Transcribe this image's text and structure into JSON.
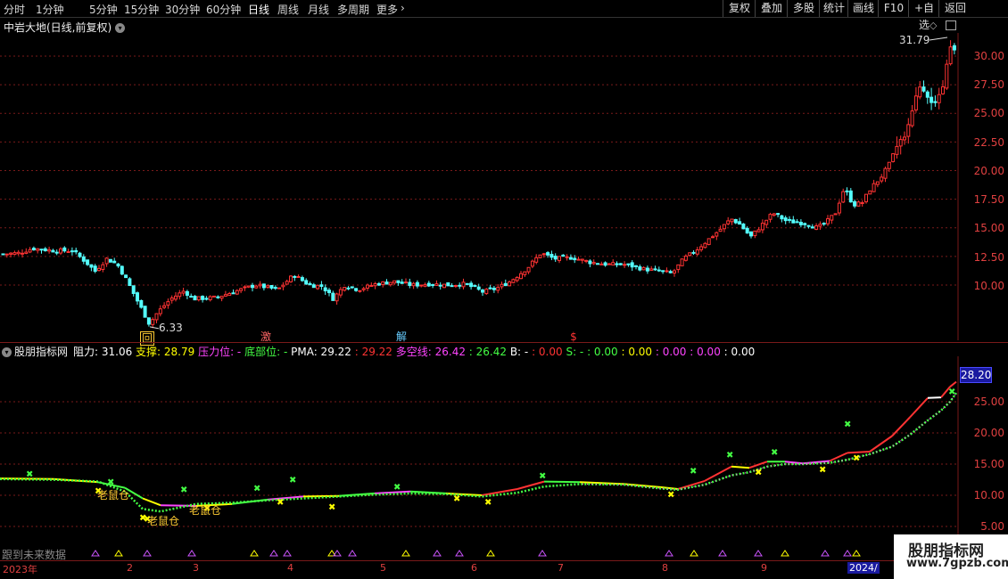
{
  "toolbar": {
    "periods": [
      "分时",
      "1分钟",
      "5分钟",
      "15分钟",
      "30分钟",
      "60分钟",
      "日线",
      "周线",
      "月线",
      "多周期",
      "更多"
    ],
    "active": "日线",
    "more_arrow": "›",
    "right_buttons": [
      "复权",
      "叠加",
      "多股",
      "统计",
      "画线",
      "F10",
      "+自选",
      "返回"
    ]
  },
  "chart_title": "中岩大地(日线,前复权)",
  "main": {
    "high_label": "31.79",
    "low_label": "6.33",
    "y_ticks": [
      "30.00",
      "27.50",
      "25.00",
      "22.50",
      "20.00",
      "17.50",
      "15.00",
      "12.50",
      "10.00"
    ],
    "signals": [
      {
        "text": "回",
        "color": "#ffcc33"
      },
      {
        "text": "激",
        "color": "#ff6666"
      },
      {
        "text": "解",
        "color": "#66ccff"
      },
      {
        "text": "$",
        "color": "#ff3333"
      }
    ]
  },
  "indicator": {
    "name": "股朋指标网",
    "items": [
      {
        "label": "阻力: ",
        "value": "31.06",
        "color": "#ffffff"
      },
      {
        "label": "支撑: ",
        "value": "28.79",
        "color": "#ffff00"
      },
      {
        "label": "压力位: ",
        "value": "-",
        "color": "#ff44ff"
      },
      {
        "label": "底部位: ",
        "value": "-",
        "color": "#44ff44"
      },
      {
        "label": "PMA: ",
        "value": "29.22",
        "color": "#ffffff"
      },
      {
        "label": ": ",
        "value": "29.22",
        "color": "#ff3333"
      },
      {
        "label": "多空线: ",
        "value": "26.42",
        "color": "#ff44ff"
      },
      {
        "label": ": ",
        "value": "26.42",
        "color": "#44ff44"
      },
      {
        "label": "B: ",
        "value": "-",
        "color": "#ffffff"
      },
      {
        "label": ": ",
        "value": "0.00",
        "color": "#ff3333"
      },
      {
        "label": "S: ",
        "value": "-",
        "color": "#44ff44"
      },
      {
        "label": ": ",
        "value": "0.00",
        "color": "#44ff44"
      },
      {
        "label": ": ",
        "value": "0.00",
        "color": "#ffff00"
      },
      {
        "label": ": ",
        "value": "0.00",
        "color": "#ff44ff"
      },
      {
        "label": ": ",
        "value": "0.00",
        "color": "#ff44ff"
      },
      {
        "label": ": ",
        "value": "0.00",
        "color": "#ffffff"
      }
    ],
    "current_value": "28.20",
    "y_ticks": [
      "25.00",
      "20.00",
      "15.00",
      "10.00",
      "5.00"
    ],
    "labels": [
      "老鼠仓",
      "老鼠仓",
      "老鼠仓"
    ],
    "footer_note": "跟到未来数据"
  },
  "x_axis": [
    "2023年",
    "2",
    "3",
    "4",
    "5",
    "6",
    "7",
    "8",
    "9",
    "2024/"
  ],
  "watermark": {
    "title": "股朋指标网",
    "url": "www.7gpzb.com"
  },
  "colors": {
    "up": "#ff3333",
    "down": "#54ffff",
    "grid": "#7a1a1a",
    "axis": "#e04040"
  }
}
